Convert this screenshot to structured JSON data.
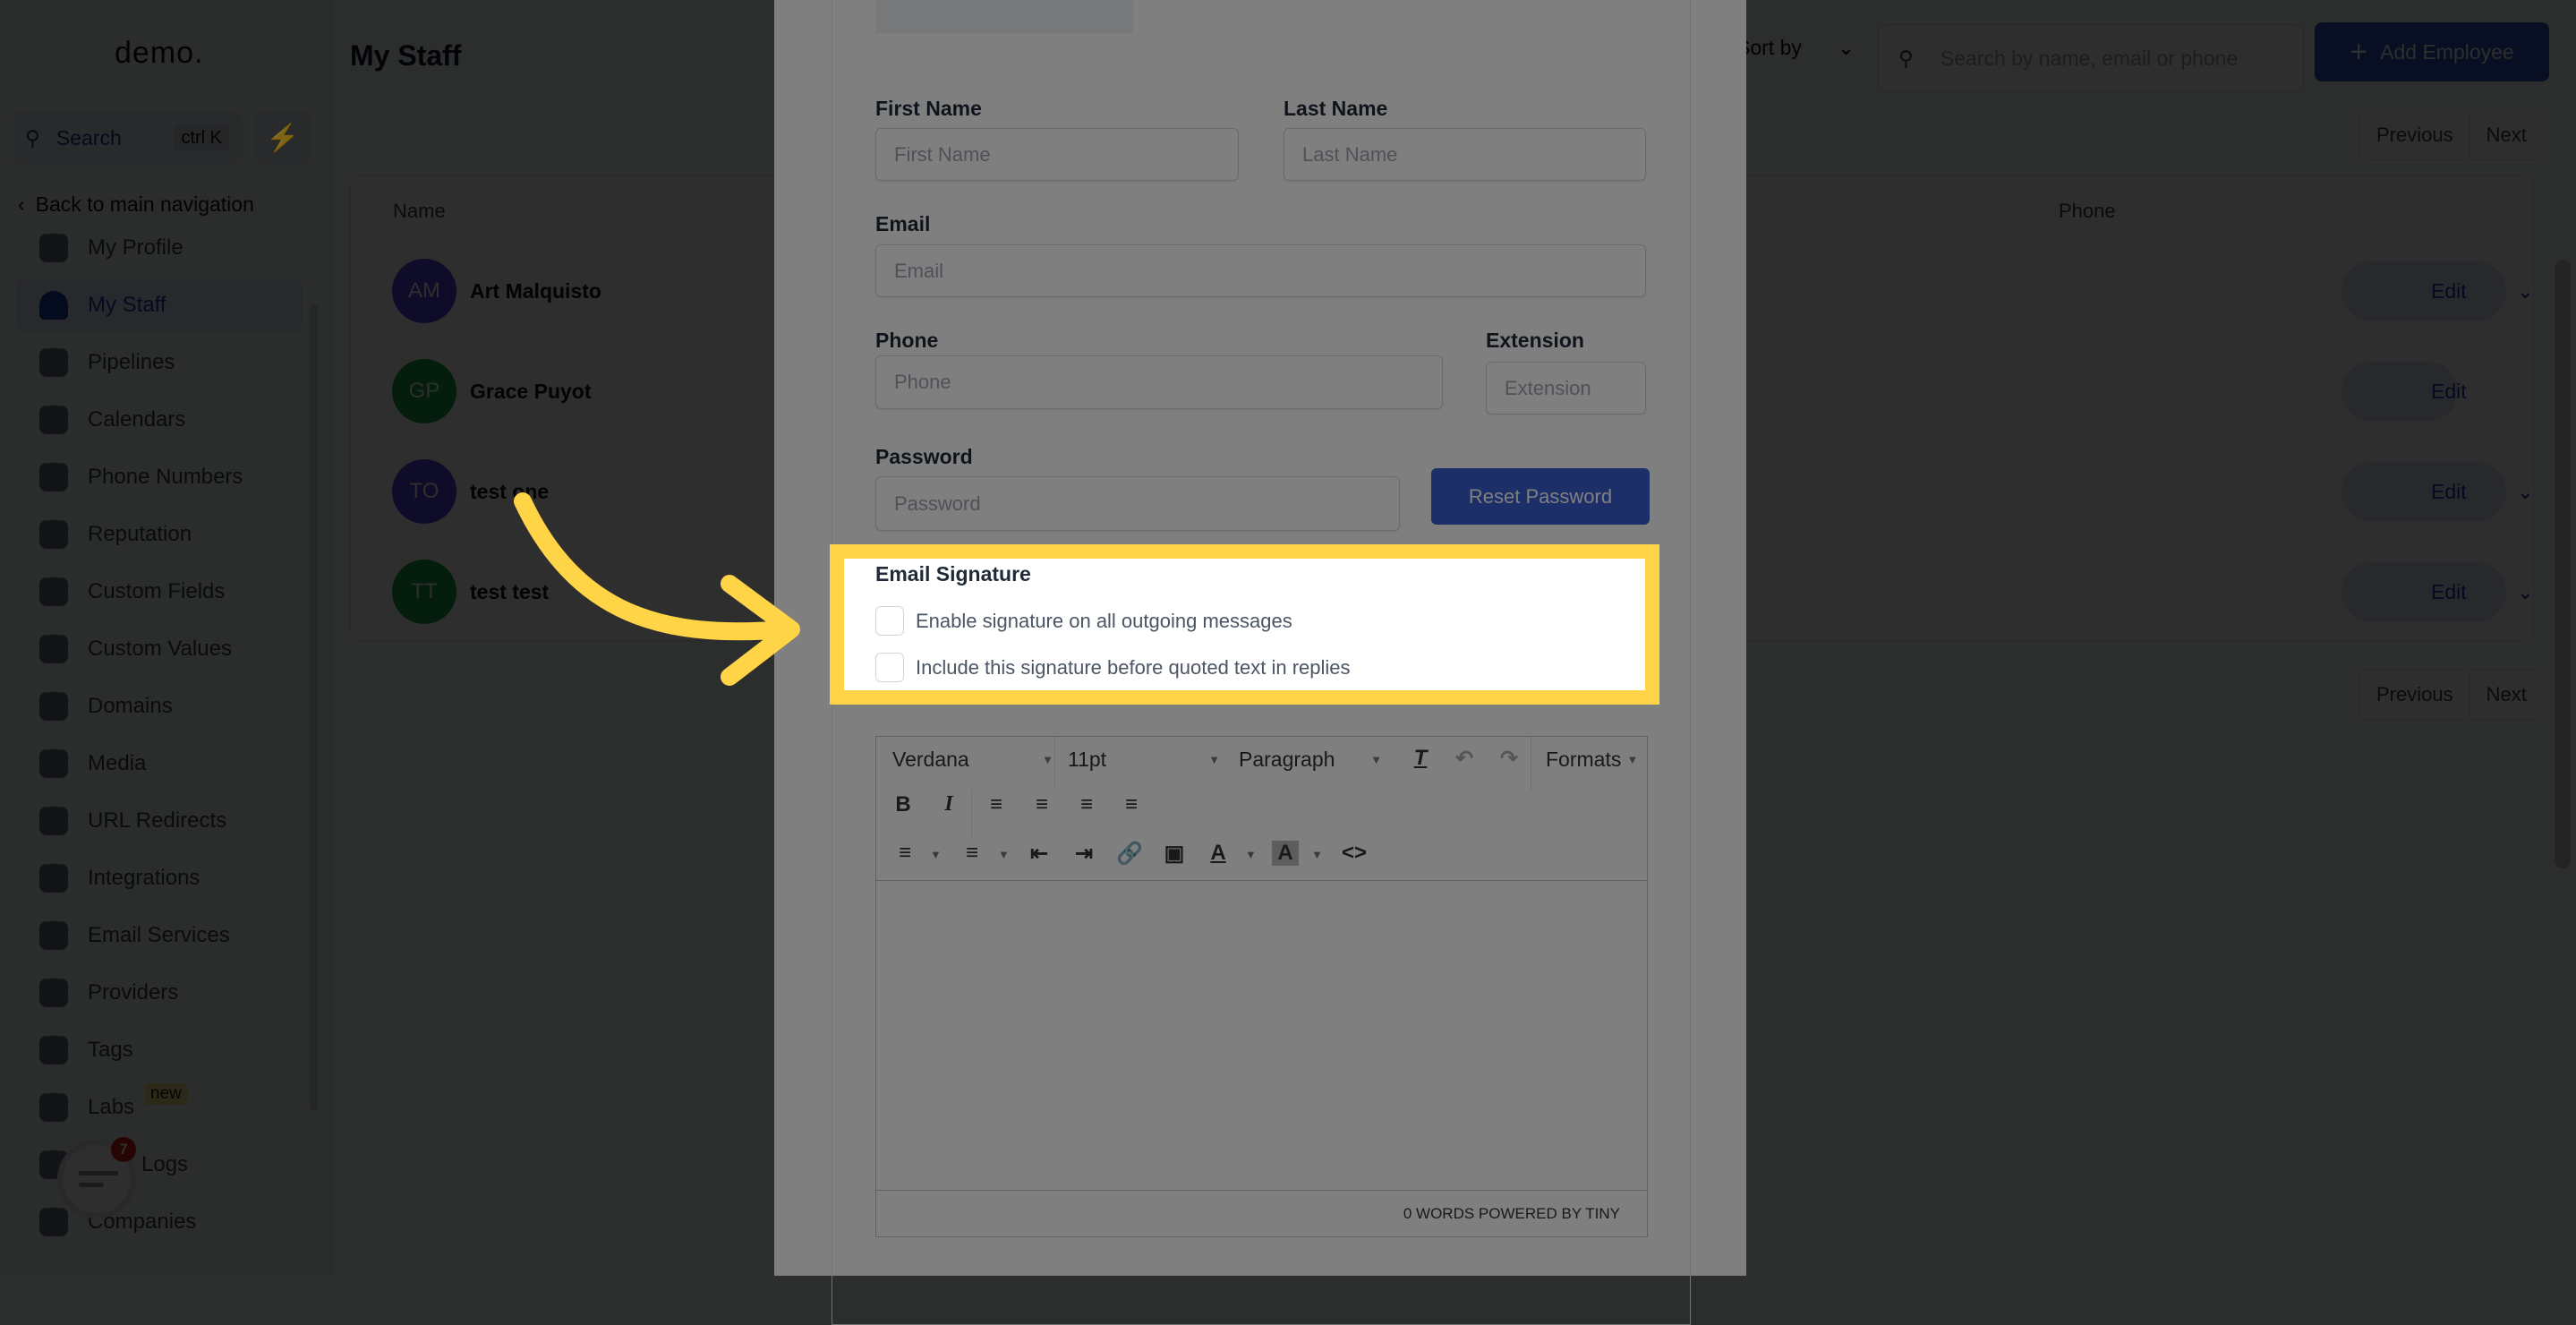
{
  "app": {
    "logo": "demo.",
    "page_title": "My Staff"
  },
  "sidebar": {
    "search_label": "Search",
    "search_shortcut": "ctrl K",
    "back_label": "Back to main navigation",
    "items": [
      {
        "label": "My Profile",
        "icon": "user-circle-icon"
      },
      {
        "label": "My Staff",
        "icon": "user-icon",
        "active": true
      },
      {
        "label": "Pipelines",
        "icon": "funnel-icon"
      },
      {
        "label": "Calendars",
        "icon": "calendar-icon"
      },
      {
        "label": "Phone Numbers",
        "icon": "phone-icon"
      },
      {
        "label": "Reputation",
        "icon": "star-icon"
      },
      {
        "label": "Custom Fields",
        "icon": "fields-icon"
      },
      {
        "label": "Custom Values",
        "icon": "diamond-icon"
      },
      {
        "label": "Domains",
        "icon": "globe-icon"
      },
      {
        "label": "Media",
        "icon": "media-icon"
      },
      {
        "label": "URL Redirects",
        "icon": "redirect-icon"
      },
      {
        "label": "Integrations",
        "icon": "integrations-icon"
      },
      {
        "label": "Email Services",
        "icon": "mail-icon"
      },
      {
        "label": "Providers",
        "icon": "clipboard-icon"
      },
      {
        "label": "Tags",
        "icon": "tag-icon"
      },
      {
        "label": "Labs",
        "icon": "flask-icon",
        "badge": "new"
      },
      {
        "label": "Logs",
        "icon": "chart-icon"
      },
      {
        "label": "Companies",
        "icon": "building-icon"
      }
    ]
  },
  "toolbar": {
    "sort_label": "Sort by",
    "search_placeholder": "Search by name, email or phone",
    "add_label": "Add Employee",
    "prev_label": "Previous",
    "next_label": "Next"
  },
  "table": {
    "columns": [
      "Name",
      "Phone"
    ],
    "edit_label": "Edit",
    "rows": [
      {
        "initials": "AM",
        "name": "Art Malquisto",
        "color": "#4f46e5",
        "dropdown": true
      },
      {
        "initials": "GP",
        "name": "Grace Puyot",
        "color": "#16a34a",
        "dropdown": false
      },
      {
        "initials": "TO",
        "name": "test one",
        "color": "#4f46e5",
        "dropdown": true
      },
      {
        "initials": "TT",
        "name": "test test",
        "color": "#16a34a",
        "dropdown": true
      }
    ]
  },
  "modal": {
    "first_name": {
      "label": "First Name",
      "placeholder": "First Name"
    },
    "last_name": {
      "label": "Last Name",
      "placeholder": "Last Name"
    },
    "email": {
      "label": "Email",
      "placeholder": "Email"
    },
    "phone": {
      "label": "Phone",
      "placeholder": "Phone"
    },
    "extension": {
      "label": "Extension",
      "placeholder": "Extension"
    },
    "password": {
      "label": "Password",
      "placeholder": "Password"
    },
    "reset_label": "Reset Password",
    "signature": {
      "title": "Email Signature",
      "options": [
        {
          "label": "Enable signature on all outgoing messages",
          "checked": false
        },
        {
          "label": "Include this signature before quoted text in replies",
          "checked": false
        }
      ]
    },
    "editor": {
      "font": "Verdana",
      "size": "11pt",
      "block": "Paragraph",
      "formats": "Formats",
      "status": "0 WORDS POWERED BY TINY"
    }
  },
  "chat": {
    "badge_count": "7"
  },
  "colors": {
    "highlight": "#ffd447",
    "primary": "#3a5fd0",
    "badge": "#e11d1d"
  }
}
